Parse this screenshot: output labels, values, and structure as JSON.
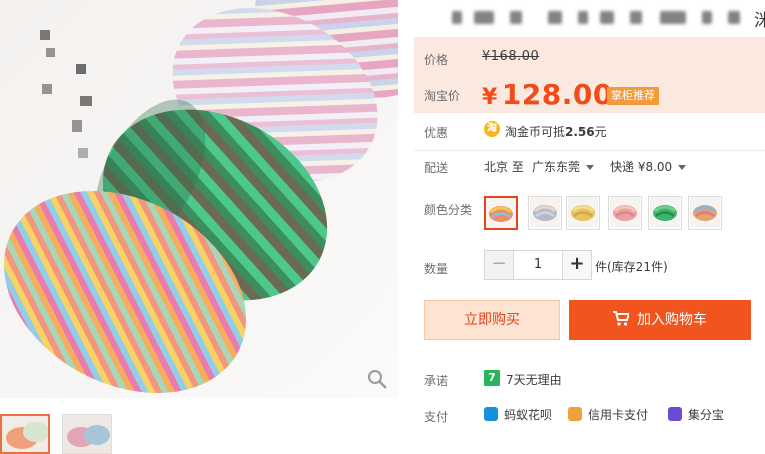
{
  "title": {
    "visible_tail": "洣"
  },
  "price": {
    "label": "价格",
    "original": "¥168.00",
    "taobao_label": "淘宝价",
    "currency": "¥",
    "amount": "128.00",
    "badge": "掌柜推荐"
  },
  "discount": {
    "label": "优惠",
    "icon_glyph": "淘",
    "text_prefix": "淘金币可抵",
    "text_amount": "2.56",
    "text_suffix": "元"
  },
  "shipping": {
    "label": "配送",
    "from": "北京 至",
    "to": "广东东莞",
    "method": "快递 ¥8.00"
  },
  "variants": {
    "label": "颜色分类",
    "swatches": [
      {
        "name": "rainbow",
        "colors": [
          "#f28a6b",
          "#f6c94b",
          "#7ec6e6"
        ]
      },
      {
        "name": "grey-multi",
        "colors": [
          "#b6b9c9",
          "#e9d6c4",
          "#d2d3de"
        ]
      },
      {
        "name": "yellow",
        "colors": [
          "#e8c35b",
          "#f2dd95",
          "#c9a94a"
        ]
      },
      {
        "name": "pink",
        "colors": [
          "#ee9fa5",
          "#f5c7b7",
          "#d98a8e"
        ]
      },
      {
        "name": "green",
        "colors": [
          "#3fb56c",
          "#6fcf8c",
          "#2a8a4f"
        ]
      },
      {
        "name": "multi-stack",
        "colors": [
          "#e7a36a",
          "#8cb6d8",
          "#d77b9a"
        ]
      }
    ]
  },
  "quantity": {
    "label": "数量",
    "minus": "−",
    "value": "1",
    "plus": "+",
    "stock": "件(库存21件)"
  },
  "buttons": {
    "buy_now": "立即购买",
    "add_to_cart": "加入购物车"
  },
  "promise": {
    "label": "承诺",
    "icon_glyph": "7",
    "text": "7天无理由"
  },
  "payment": {
    "label": "支付",
    "methods": [
      {
        "name": "蚂蚁花呗",
        "color": "#1890e0"
      },
      {
        "name": "信用卡支付",
        "color": "#f0a13a"
      },
      {
        "name": "集分宝",
        "color": "#6b4bd6"
      }
    ]
  },
  "colors": {
    "accent": "#f14b1a",
    "cart_button": "#f1541d",
    "buy_button_bg": "#fde4d2",
    "price_box_bg": "#fbe9df",
    "badge_bg": "#f29a3e"
  }
}
